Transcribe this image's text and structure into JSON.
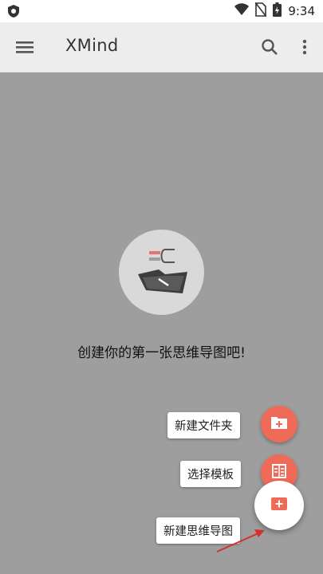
{
  "status_bar": {
    "time": "9:34",
    "icons": [
      "shield-icon",
      "wifi-icon",
      "no-sim-icon",
      "battery-icon"
    ]
  },
  "app_bar": {
    "title": "XMind",
    "icons": [
      "menu-icon",
      "search-icon",
      "more-vert-icon"
    ]
  },
  "empty_state": {
    "message": "创建你的第一张思维导图吧!",
    "icon": "empty-folder-illustration"
  },
  "fab_menu": {
    "items": [
      {
        "label": "新建文件夹",
        "icon": "folder-add-icon"
      },
      {
        "label": "选择模板",
        "icon": "template-icon"
      },
      {
        "label": "新建思维导图",
        "icon": "add-map-icon"
      }
    ]
  },
  "colors": {
    "accent": "#ef6b57",
    "overlay": "#9e9e9e",
    "arrow": "#d32f2f"
  }
}
